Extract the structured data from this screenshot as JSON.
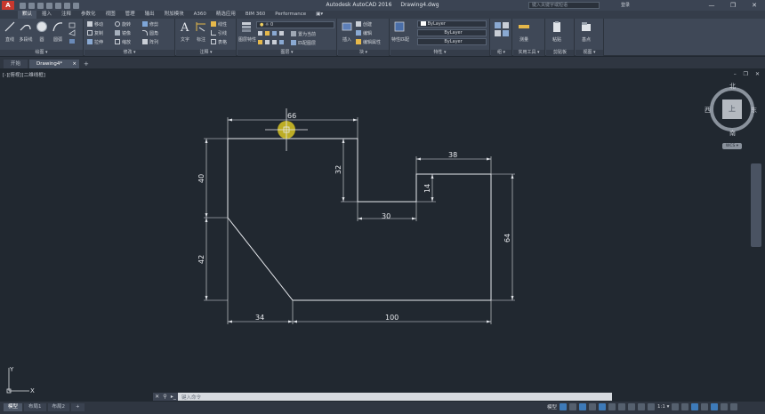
{
  "window": {
    "app_name": "Autodesk AutoCAD 2016",
    "file_name": "Drawing4.dwg",
    "search_placeholder": "键入关键字或短语",
    "signin_label": "登录",
    "controls": [
      "—",
      "❐",
      "✕"
    ]
  },
  "ribbon_tabs": [
    "默认",
    "插入",
    "注释",
    "参数化",
    "视图",
    "管理",
    "输出",
    "附加模块",
    "A360",
    "精选应用",
    "BIM 360",
    "Performance",
    "▣▾"
  ],
  "ribbon": {
    "draw": {
      "title": "绘图 ▾",
      "line": "直线",
      "polyline": "多段线",
      "circle": "圆",
      "arc": "圆弧"
    },
    "modify": {
      "title": "修改 ▾",
      "move": "移动",
      "rotate": "旋转",
      "trim": "修剪",
      "copy": "复制",
      "mirror": "镜像",
      "fillet": "圆角",
      "stretch": "拉伸",
      "scale": "缩放",
      "array": "阵列"
    },
    "annotation": {
      "title": "注释 ▾",
      "text": "文字",
      "dimension": "标注",
      "linear": "线性",
      "leader": "引线",
      "table": "表格"
    },
    "layers": {
      "title": "图层 ▾",
      "properties": "图层特性",
      "current_layer": "0",
      "make_current": "置为当前",
      "match_layer": "匹配图层"
    },
    "block": {
      "title": "块 ▾",
      "insert": "插入",
      "create": "创建",
      "edit": "编辑",
      "edit_attr": "编辑属性"
    },
    "properties": {
      "title": "特性 ▾",
      "match": "特性匹配",
      "color": "ByLayer",
      "linetype": "ByLayer",
      "lineweight": "ByLayer"
    },
    "groups": {
      "title": "组 ▾",
      "group": "组"
    },
    "utilities": {
      "title": "实用工具 ▾",
      "measure": "测量"
    },
    "clipboard": {
      "title": "剪贴板",
      "paste": "粘贴"
    },
    "view": {
      "title": "视图 ▾",
      "base": "基点"
    }
  },
  "file_tabs": [
    "开始",
    "Drawing4*"
  ],
  "viewport": {
    "label": "[-][俯视][二维线框]",
    "controls": "–  ❐  ✕"
  },
  "viewcube": {
    "north": "北",
    "south": "南",
    "east": "东",
    "west": "西",
    "face": "上",
    "wcs": "WCS ▾"
  },
  "dimensions": {
    "top_width": "66",
    "notch_depth": "32",
    "notch_width": "30",
    "step_height": "14",
    "right_top": "38",
    "right_height": "64",
    "left_upper": "40",
    "left_lower": "42",
    "bottom_left": "34",
    "bottom_right": "100"
  },
  "ucs": {
    "x": "X",
    "y": "Y"
  },
  "command_line": {
    "buttons": [
      "✕",
      "⚲",
      "▸_"
    ],
    "placeholder": "键入命令"
  },
  "layout_tabs": [
    "模型",
    "布局1",
    "布局2",
    "+"
  ],
  "status": {
    "model": "模型",
    "scale": "1:1 ▾"
  }
}
